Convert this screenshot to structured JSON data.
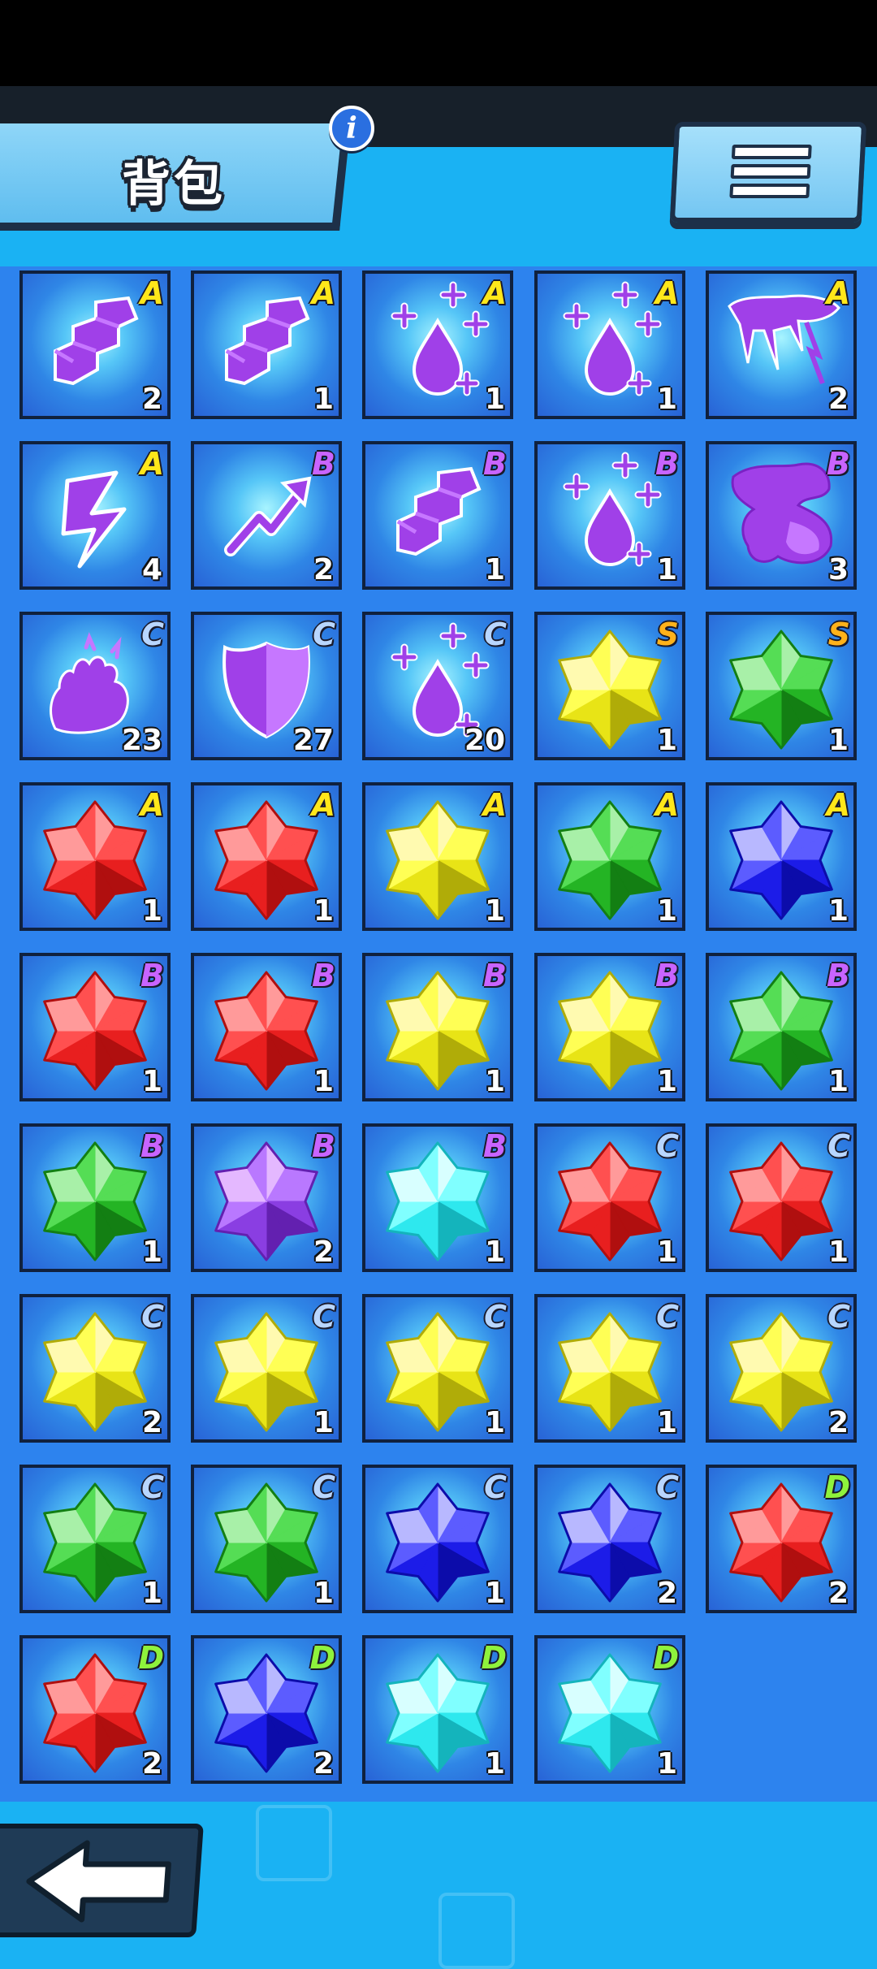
{
  "header": {
    "title": "背包",
    "info_icon_glyph": "i"
  },
  "menu": {
    "icon": "hamburger-menu-icon"
  },
  "back": {
    "icon": "left-arrow-icon"
  },
  "grade_colors": {
    "S": "#ffb21a",
    "A": "#ffe71a",
    "B": "#c964ff",
    "C": "#b8d6ff",
    "D": "#8ff23c"
  },
  "gem_colors": {
    "red": [
      "#ff9a9a",
      "#ff5050",
      "#e81f1f",
      "#b00f0f"
    ],
    "yellow": [
      "#fffab0",
      "#ffff55",
      "#e8e416",
      "#b0ac08"
    ],
    "green": [
      "#a8f0a8",
      "#55dd55",
      "#24b424",
      "#137f13"
    ],
    "blue": [
      "#b8b8ff",
      "#5c5cff",
      "#1c1ce8",
      "#0c0caa"
    ],
    "purple": [
      "#e4b8ff",
      "#b978ff",
      "#8a3ee2",
      "#6320b0"
    ],
    "cyan": [
      "#d8ffff",
      "#80ffff",
      "#2ee8ee",
      "#14b4bc"
    ]
  },
  "items": [
    {
      "kind": "ability",
      "icon": "stairs-icon",
      "grade": "A",
      "qty": "2"
    },
    {
      "kind": "ability",
      "icon": "stairs-icon",
      "grade": "A",
      "qty": "1"
    },
    {
      "kind": "ability",
      "icon": "heal-drop-icon",
      "grade": "A",
      "qty": "1"
    },
    {
      "kind": "ability",
      "icon": "heal-drop-icon",
      "grade": "A",
      "qty": "1"
    },
    {
      "kind": "ability",
      "icon": "lightning-cloud-icon",
      "grade": "A",
      "qty": "2"
    },
    {
      "kind": "ability",
      "icon": "lightning-bolt-icon",
      "grade": "A",
      "qty": "4"
    },
    {
      "kind": "ability",
      "icon": "growth-arrow-icon",
      "grade": "B",
      "qty": "2"
    },
    {
      "kind": "ability",
      "icon": "stairs-icon",
      "grade": "B",
      "qty": "1"
    },
    {
      "kind": "ability",
      "icon": "heal-drop-icon",
      "grade": "B",
      "qty": "1"
    },
    {
      "kind": "ability",
      "icon": "dragon-icon",
      "grade": "B",
      "qty": "3"
    },
    {
      "kind": "ability",
      "icon": "burning-hand-icon",
      "grade": "C",
      "qty": "23"
    },
    {
      "kind": "ability",
      "icon": "shield-icon",
      "grade": "C",
      "qty": "27"
    },
    {
      "kind": "ability",
      "icon": "heal-drop-icon",
      "grade": "C",
      "qty": "20"
    },
    {
      "kind": "gem",
      "color": "yellow",
      "grade": "S",
      "qty": "1"
    },
    {
      "kind": "gem",
      "color": "green",
      "grade": "S",
      "qty": "1"
    },
    {
      "kind": "gem",
      "color": "red",
      "grade": "A",
      "qty": "1"
    },
    {
      "kind": "gem",
      "color": "red",
      "grade": "A",
      "qty": "1"
    },
    {
      "kind": "gem",
      "color": "yellow",
      "grade": "A",
      "qty": "1"
    },
    {
      "kind": "gem",
      "color": "green",
      "grade": "A",
      "qty": "1"
    },
    {
      "kind": "gem",
      "color": "blue",
      "grade": "A",
      "qty": "1"
    },
    {
      "kind": "gem",
      "color": "red",
      "grade": "B",
      "qty": "1"
    },
    {
      "kind": "gem",
      "color": "red",
      "grade": "B",
      "qty": "1"
    },
    {
      "kind": "gem",
      "color": "yellow",
      "grade": "B",
      "qty": "1"
    },
    {
      "kind": "gem",
      "color": "yellow",
      "grade": "B",
      "qty": "1"
    },
    {
      "kind": "gem",
      "color": "green",
      "grade": "B",
      "qty": "1"
    },
    {
      "kind": "gem",
      "color": "green",
      "grade": "B",
      "qty": "1"
    },
    {
      "kind": "gem",
      "color": "purple",
      "grade": "B",
      "qty": "2"
    },
    {
      "kind": "gem",
      "color": "cyan",
      "grade": "B",
      "qty": "1"
    },
    {
      "kind": "gem",
      "color": "red",
      "grade": "C",
      "qty": "1"
    },
    {
      "kind": "gem",
      "color": "red",
      "grade": "C",
      "qty": "1"
    },
    {
      "kind": "gem",
      "color": "yellow",
      "grade": "C",
      "qty": "2"
    },
    {
      "kind": "gem",
      "color": "yellow",
      "grade": "C",
      "qty": "1"
    },
    {
      "kind": "gem",
      "color": "yellow",
      "grade": "C",
      "qty": "1"
    },
    {
      "kind": "gem",
      "color": "yellow",
      "grade": "C",
      "qty": "1"
    },
    {
      "kind": "gem",
      "color": "yellow",
      "grade": "C",
      "qty": "2"
    },
    {
      "kind": "gem",
      "color": "green",
      "grade": "C",
      "qty": "1"
    },
    {
      "kind": "gem",
      "color": "green",
      "grade": "C",
      "qty": "1"
    },
    {
      "kind": "gem",
      "color": "blue",
      "grade": "C",
      "qty": "1"
    },
    {
      "kind": "gem",
      "color": "blue",
      "grade": "C",
      "qty": "2"
    },
    {
      "kind": "gem",
      "color": "red",
      "grade": "D",
      "qty": "2"
    },
    {
      "kind": "gem",
      "color": "red",
      "grade": "D",
      "qty": "2"
    },
    {
      "kind": "gem",
      "color": "blue",
      "grade": "D",
      "qty": "2"
    },
    {
      "kind": "gem",
      "color": "cyan",
      "grade": "D",
      "qty": "1"
    },
    {
      "kind": "gem",
      "color": "cyan",
      "grade": "D",
      "qty": "1"
    }
  ]
}
